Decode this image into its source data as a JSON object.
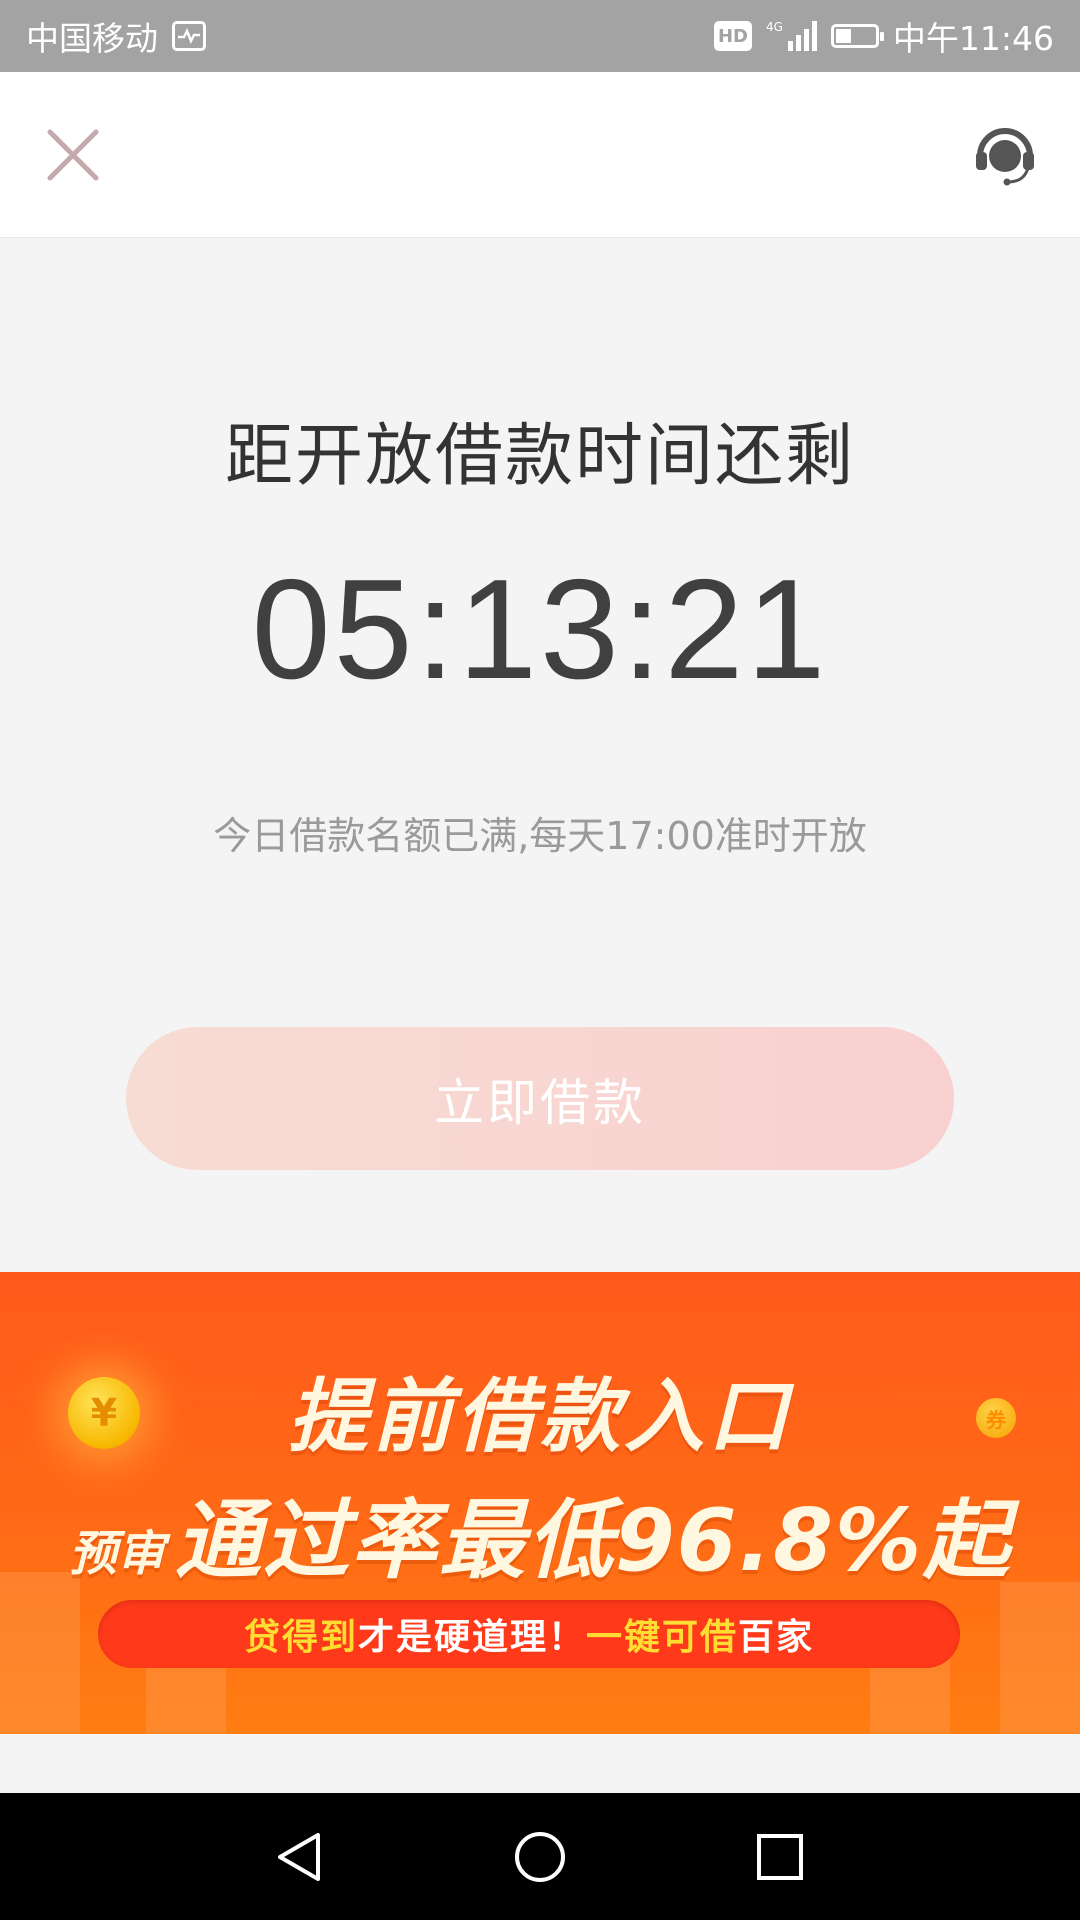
{
  "status_bar": {
    "carrier": "中国移动",
    "activity_icon": "pulse-icon",
    "hd_label": "HD",
    "network_label": "4G",
    "battery_level": 0.4,
    "time": "中午11:46"
  },
  "header": {
    "close_icon": "close-icon",
    "support_icon": "customer-service-icon"
  },
  "countdown": {
    "title": "距开放借款时间还剩",
    "time": "05:13:21",
    "notice": "今日借款名额已满,每天17:00准时开放"
  },
  "borrow_button": {
    "label": "立即借款"
  },
  "banner": {
    "title": "提前借款入口",
    "sub_prefix": "预审",
    "sub_main": "通过率最低96.8%起",
    "coin_big_symbol": "¥",
    "coin_small_symbol": "券",
    "slogan_part1": "贷得到",
    "slogan_part2": "才是硬道理！",
    "slogan_part3": "一键可借",
    "slogan_part4": "百家"
  },
  "nav_bar": {
    "back_icon": "back-triangle-icon",
    "home_icon": "home-circle-icon",
    "recents_icon": "recents-square-icon"
  },
  "colors": {
    "status_bar_bg": "#a3a3a3",
    "page_bg": "#f4f4f4",
    "button_gradient_start": "#f7dcd3",
    "button_gradient_end": "#f8d0d0",
    "banner_orange": "#ff5a1b",
    "banner_pill_red": "#ff3a1a",
    "banner_highlight_yellow": "#ffdd33"
  }
}
